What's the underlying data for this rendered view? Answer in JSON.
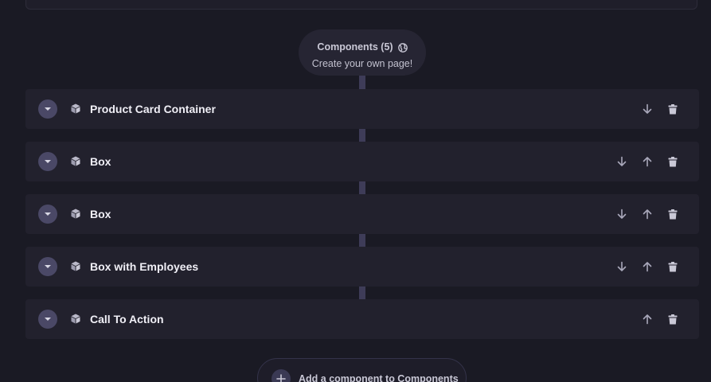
{
  "header": {
    "title": "Components (5)",
    "subtitle": "Create your own page!",
    "icon": "globe-icon"
  },
  "components": [
    {
      "label": "Product Card Container",
      "actions": [
        "move-down",
        "delete"
      ]
    },
    {
      "label": "Box",
      "actions": [
        "move-down",
        "move-up",
        "delete"
      ]
    },
    {
      "label": "Box",
      "actions": [
        "move-down",
        "move-up",
        "delete"
      ]
    },
    {
      "label": "Box with Employees",
      "actions": [
        "move-down",
        "move-up",
        "delete"
      ]
    },
    {
      "label": "Call To Action",
      "actions": [
        "move-up",
        "delete"
      ]
    }
  ],
  "add_button": {
    "label": "Add a component to Components",
    "icon": "plus-icon"
  },
  "colors": {
    "background": "#1a1a24",
    "row": "#22212d",
    "accent": "#4a4866",
    "connector": "#3e3c58"
  }
}
